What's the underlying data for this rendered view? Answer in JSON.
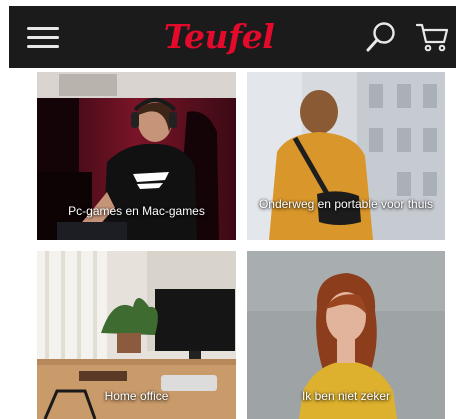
{
  "header": {
    "logo_text": "Teufel",
    "icons": {
      "menu": "hamburger-menu-icon",
      "search": "search-icon",
      "cart": "shopping-cart-icon"
    },
    "colors": {
      "background": "#1b1b1b",
      "logo": "#e30a2b",
      "icon": "#e8e8e8"
    }
  },
  "categories": [
    {
      "label": "Pc-games en Mac-games"
    },
    {
      "label": "Onderweg en portable voor thuis"
    },
    {
      "label": "Home office"
    },
    {
      "label": "Ik ben niet zeker"
    }
  ]
}
